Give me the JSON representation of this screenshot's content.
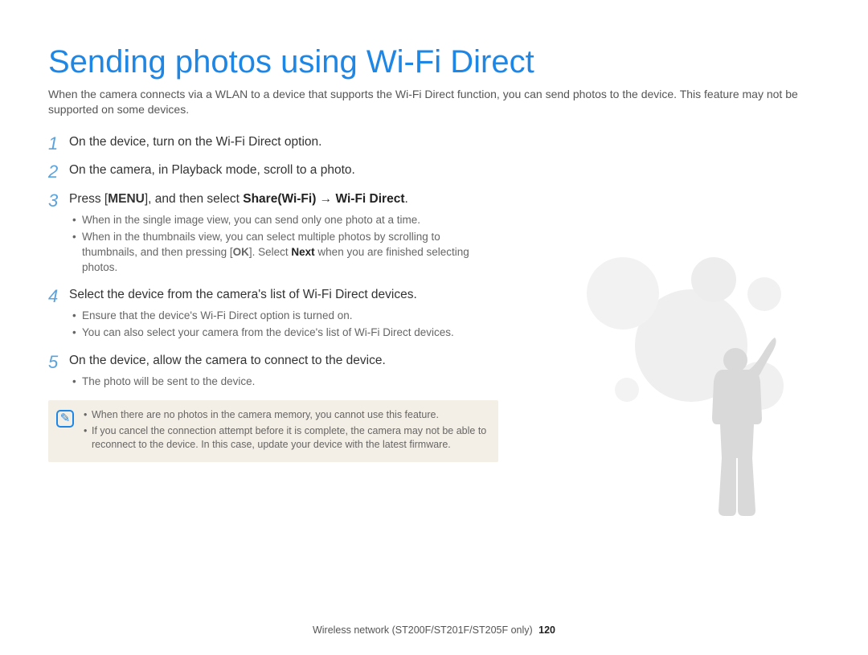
{
  "title": "Sending photos using Wi-Fi Direct",
  "intro": "When the camera connects via a WLAN to a device that supports the Wi-Fi Direct function, you can send photos to the device. This feature may not be supported on some devices.",
  "steps": {
    "s1": "On the device, turn on the Wi-Fi Direct option.",
    "s2": "On the camera, in Playback mode, scroll to a photo.",
    "s3_pre": "Press [",
    "s3_menu": "MENU",
    "s3_mid": "], and then select ",
    "s3_share": "Share(Wi-Fi)",
    "s3_arrow": " → ",
    "s3_wifidirect": "Wi-Fi Direct",
    "s3_end": ".",
    "s3_sub1": "When in the single image view, you can send only one photo at a time.",
    "s3_sub2_pre": "When in the thumbnails view, you can select multiple photos by scrolling to thumbnails, and then pressing [",
    "s3_sub2_ok": "OK",
    "s3_sub2_post1": "]. Select ",
    "s3_sub2_next": "Next",
    "s3_sub2_post2": " when you are finished selecting photos.",
    "s4": "Select the device from the camera's list of Wi-Fi Direct devices.",
    "s4_sub1": "Ensure that the device's Wi-Fi Direct option is turned on.",
    "s4_sub2": "You can also select your camera from the device's list of Wi-Fi Direct devices.",
    "s5": "On the device, allow the camera to connect to the device.",
    "s5_sub1": "The photo will be sent to the device."
  },
  "note": {
    "n1": "When there are no photos in the camera memory, you cannot use this feature.",
    "n2": "If you cancel the connection attempt before it is complete, the camera may not be able to reconnect to the device. In this case, update your device with the latest firmware."
  },
  "footer": {
    "text": "Wireless network (ST200F/ST201F/ST205F only)",
    "page": "120"
  }
}
